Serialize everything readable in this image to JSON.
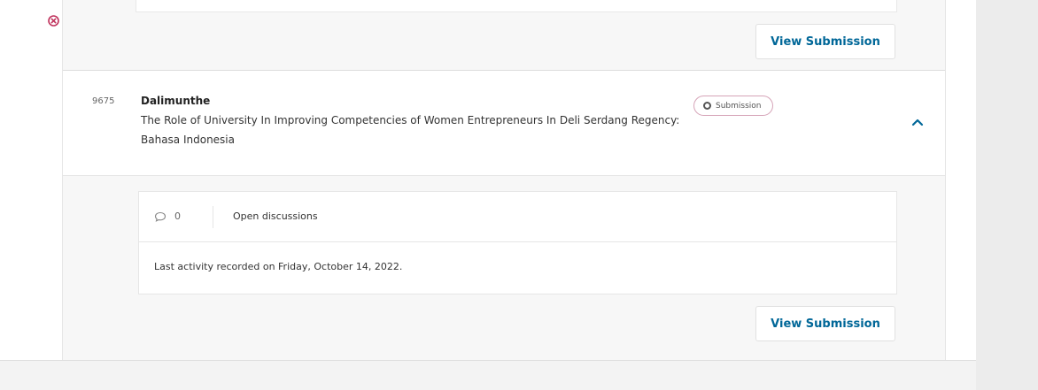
{
  "previous_item": {
    "view_label": "View Submission"
  },
  "submission": {
    "id": "9675",
    "author": "Dalimunthe",
    "title": "The Role of University In Improving Competencies of Women Entrepreneurs In Deli Serdang Regency: Bahasa Indonesia",
    "stage": "Submission",
    "discussion_count": "0",
    "discussions_label": "Open discussions",
    "last_activity": "Last activity recorded on Friday, October 14, 2022.",
    "view_label": "View Submission"
  },
  "colors": {
    "link": "#006798",
    "accent_pink": "#c0325c",
    "side_panel": "#ececec"
  },
  "icons": {
    "top_left": "close-circle-icon",
    "stage": "stage-circle-icon",
    "discussion": "comment-icon",
    "toggle": "chevron-up-icon"
  }
}
